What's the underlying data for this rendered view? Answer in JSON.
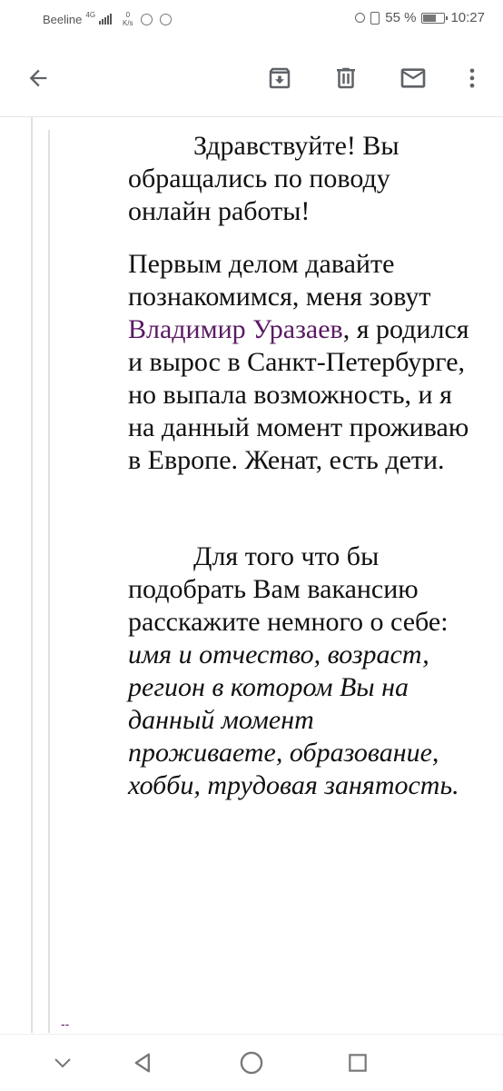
{
  "status_bar": {
    "carrier": "Beeline",
    "network": "4G",
    "speed_value": "0",
    "speed_unit": "K/s",
    "battery": "55 %",
    "time": "10:27",
    "icons": [
      "signal-icon",
      "viber-icon",
      "whatsapp-icon",
      "alarm-icon",
      "vibrate-icon",
      "battery-icon"
    ]
  },
  "toolbar": {
    "icons": [
      "back-arrow-icon",
      "archive-icon",
      "delete-icon",
      "mark-unread-icon",
      "more-vert-icon"
    ]
  },
  "message": {
    "p1": "Здравствуйте! Вы обращались по поводу онлайн работы!",
    "p2_before": "Первым делом давайте познакомимся, меня зовут ",
    "p2_name": "Владимир Уразаев",
    "p2_after": ", я родился и вырос в Санкт-Петербурге, но выпала возможность, и я на данный момент проживаю в Европе. Женат, есть дети.",
    "p3_normal": "Для того что бы подобрать Вам вакансию расскажите немного о себе: ",
    "p3_italic": "имя и отчество, возраст, регион в котором Вы на данный момент проживаете, образование, хобби, трудовая занятость.",
    "signature_sep": "--"
  },
  "colors": {
    "link": "#5a1a63",
    "icon": "#5f6368",
    "quote_line": "#e0e0e0"
  },
  "nav_bar": {
    "icons": [
      "hide-nav-icon",
      "nav-back-icon",
      "nav-home-icon",
      "nav-recents-icon"
    ]
  }
}
